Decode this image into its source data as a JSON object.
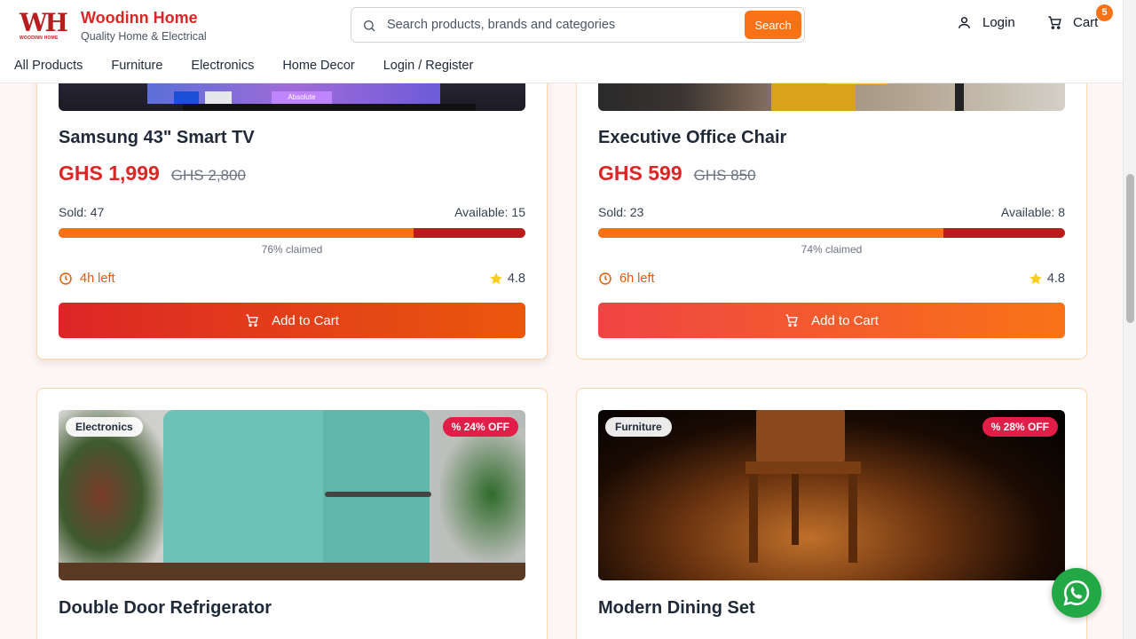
{
  "header": {
    "brand_name": "Woodinn Home",
    "brand_tagline": "Quality Home & Electrical",
    "logo_letters": "WH",
    "logo_subtext": "WOODINN HOME",
    "search_placeholder": "Search products, brands and categories",
    "search_button": "Search",
    "login_label": "Login",
    "cart_label": "Cart",
    "cart_count": "5"
  },
  "nav": {
    "items": [
      "All Products",
      "Furniture",
      "Electronics",
      "Home Decor",
      "Login / Register"
    ]
  },
  "products": [
    {
      "title": "Samsung 43\" Smart TV",
      "price": "GHS 1,999",
      "old_price": "GHS 2,800",
      "sold": "Sold: 47",
      "available": "Available: 15",
      "claimed_fraction": 0.76,
      "claimed": "76% claimed",
      "time_left": "4h left",
      "rating": "4.8",
      "button": "Add to Cart",
      "image_text": "Absolute"
    },
    {
      "title": "Executive Office Chair",
      "price": "GHS 599",
      "old_price": "GHS 850",
      "sold": "Sold: 23",
      "available": "Available: 8",
      "claimed_fraction": 0.74,
      "claimed": "74% claimed",
      "time_left": "6h left",
      "rating": "4.8",
      "button": "Add to Cart"
    },
    {
      "title": "Double Door Refrigerator",
      "category": "Electronics",
      "discount": "24% OFF"
    },
    {
      "title": "Modern Dining Set",
      "category": "Furniture",
      "discount": "28% OFF"
    }
  ],
  "icons": {
    "search": "search-icon",
    "user": "user-icon",
    "cart": "cart-icon",
    "clock": "clock-icon",
    "star": "star-icon",
    "percent": "percent-icon",
    "whatsapp": "whatsapp-icon"
  },
  "colors": {
    "brand_red": "#dc2626",
    "accent_orange": "#f97316",
    "star_yellow": "#facc15",
    "whatsapp_green": "#22a845"
  }
}
